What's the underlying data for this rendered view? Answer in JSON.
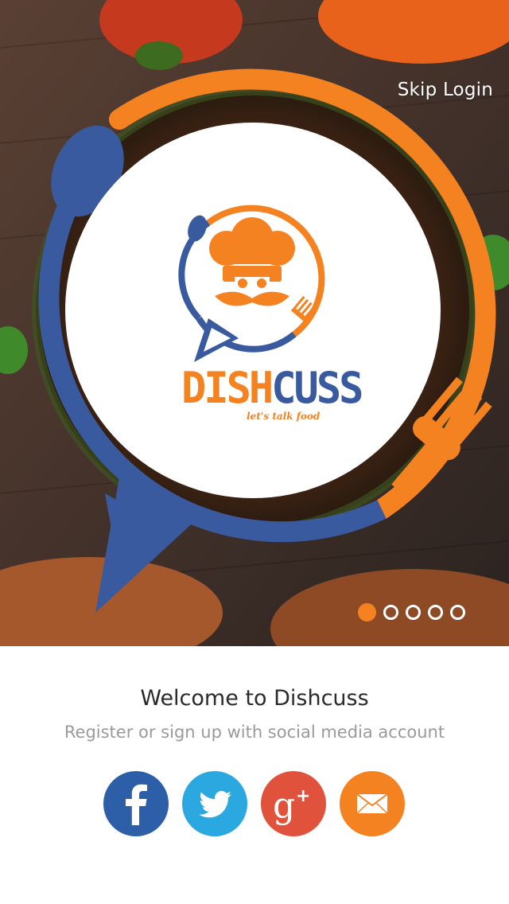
{
  "header": {
    "skip_label": "Skip Login"
  },
  "logo": {
    "brand_part1": "DISH",
    "brand_part2": "CUSS",
    "tagline": "let's talk food"
  },
  "carousel": {
    "total": 5,
    "active_index": 0
  },
  "welcome": {
    "title": "Welcome to Dishcuss",
    "subtitle": "Register or sign up with social media account"
  },
  "social": [
    {
      "name": "facebook",
      "icon": "facebook-icon",
      "color": "#2c5fa8"
    },
    {
      "name": "twitter",
      "icon": "twitter-icon",
      "color": "#2ca8e0"
    },
    {
      "name": "google-plus",
      "icon": "google-plus-icon",
      "color": "#e0523b"
    },
    {
      "name": "email",
      "icon": "mail-icon",
      "color": "#f58220"
    }
  ],
  "colors": {
    "orange": "#f58220",
    "blue": "#3a5aa0",
    "white": "#ffffff"
  }
}
